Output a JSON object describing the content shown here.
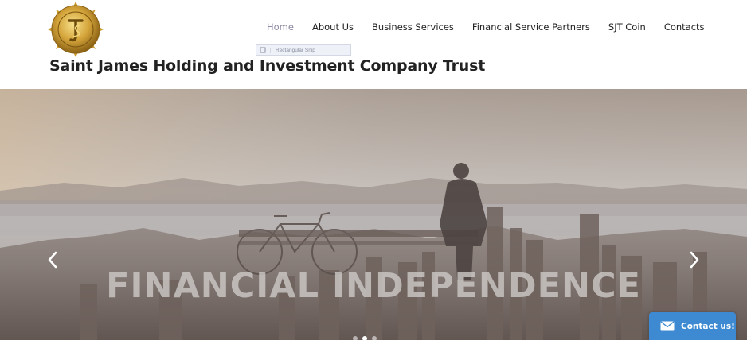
{
  "header": {
    "site_title": "Saint James Holding and Investment Company Trust",
    "logo": {
      "icon": "gold-coin-logo-icon",
      "text": "SAINT JAMES HOLDING"
    }
  },
  "nav": {
    "items": [
      {
        "label": "Home",
        "active": true
      },
      {
        "label": "About Us",
        "active": false
      },
      {
        "label": "Business Services",
        "active": false
      },
      {
        "label": "Financial Service Partners",
        "active": false
      },
      {
        "label": "SJT Coin",
        "active": false
      },
      {
        "label": "Contacts",
        "active": false
      }
    ],
    "active_color": "#8d8aa3"
  },
  "snip_overlay": {
    "label": "Rectangular Snip"
  },
  "hero": {
    "headline": "FINANCIAL INDEPENDENCE",
    "prev_icon": "chevron-left-icon",
    "next_icon": "chevron-right-icon",
    "slides_count": 3,
    "active_slide": 1
  },
  "contact_widget": {
    "label": "Contact us!",
    "icon": "envelope-icon",
    "color": "#3d8ad2"
  }
}
